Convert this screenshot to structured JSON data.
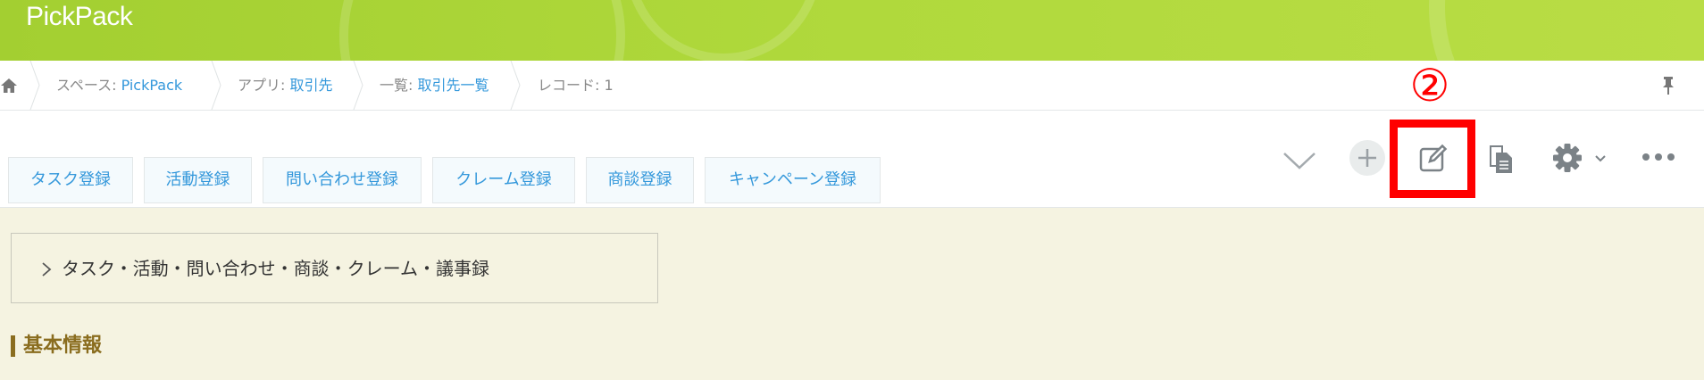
{
  "header": {
    "app_title": "PickPack"
  },
  "breadcrumb": {
    "space_prefix": "スペース: ",
    "space_name": "PickPack",
    "app_prefix": "アプリ: ",
    "app_name": "取引先",
    "list_prefix": "一覧: ",
    "list_name": "取引先一覧",
    "record_label": "レコード: 1"
  },
  "tabs": [
    "タスク登録",
    "活動登録",
    "問い合わせ登録",
    "クレーム登録",
    "商談登録",
    "キャンペーン登録"
  ],
  "annotation": {
    "step_number": "②",
    "highlight_color": "#ff0000"
  },
  "section": {
    "related_records_label": "タスク・活動・問い合わせ・商談・クレーム・議事録"
  },
  "group": {
    "basic_info_label": "基本情報"
  },
  "colors": {
    "header_green": "#a3cf31",
    "link_blue": "#3498db",
    "background": "#f5f3e1",
    "group_brown": "#8a6d1f"
  },
  "icons": [
    "home-icon",
    "pin-icon",
    "chevron-down-icon",
    "add-icon",
    "edit-icon",
    "duplicate-icon",
    "gear-icon",
    "more-icon",
    "chevron-right-icon"
  ]
}
